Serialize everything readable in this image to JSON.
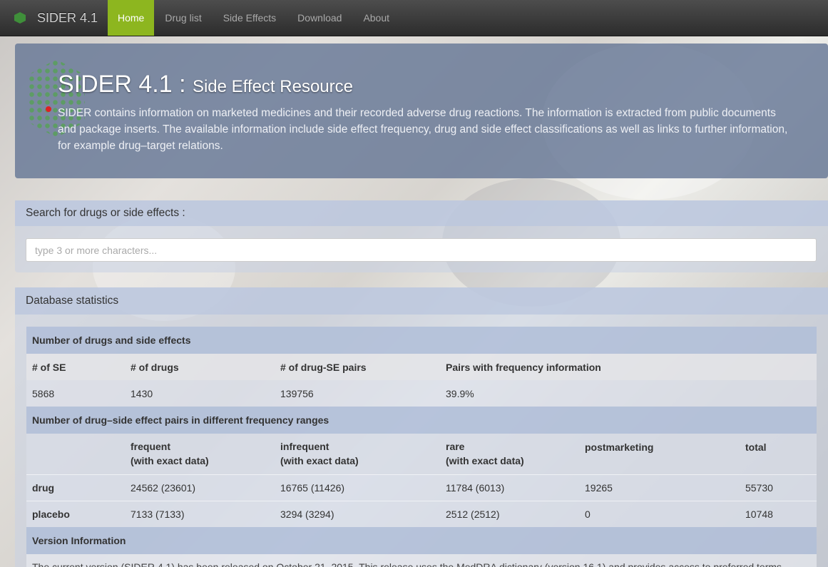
{
  "navbar": {
    "brand": "SIDER 4.1",
    "items": [
      {
        "label": "Home",
        "active": true
      },
      {
        "label": "Drug list",
        "active": false
      },
      {
        "label": "Side Effects",
        "active": false
      },
      {
        "label": "Download",
        "active": false
      },
      {
        "label": "About",
        "active": false
      }
    ]
  },
  "hero": {
    "title": "SIDER 4.1",
    "separator": " : ",
    "subtitle": "Side Effect Resource",
    "text": "SIDER contains information on marketed medicines and their recorded adverse drug reactions. The information is extracted from public documents and package inserts. The available information include side effect frequency, drug and side effect classifications as well as links to further information, for example drug–target relations."
  },
  "search": {
    "heading": "Search for drugs or side effects :",
    "placeholder": "type 3 or more characters..."
  },
  "stats": {
    "heading": "Database statistics",
    "section1": "Number of drugs and side effects",
    "columns1": [
      "# of SE",
      "# of drugs",
      "# of drug-SE pairs",
      "Pairs with frequency information"
    ],
    "values1": [
      "5868",
      "1430",
      "139756",
      "39.9%"
    ],
    "section2": "Number of drug–side effect pairs in different frequency ranges",
    "columns2": [
      {
        "line1": "",
        "line2": ""
      },
      {
        "line1": "frequent",
        "line2": "(with exact data)"
      },
      {
        "line1": "infrequent",
        "line2": "(with exact data)"
      },
      {
        "line1": "rare",
        "line2": "(with exact data)"
      },
      {
        "line1": "postmarketing",
        "line2": ""
      },
      {
        "line1": "total",
        "line2": ""
      }
    ],
    "rows2": [
      [
        "drug",
        "24562 (23601)",
        "16765 (11426)",
        "11784 (6013)",
        "19265",
        "55730"
      ],
      [
        "placebo",
        "7133 (7133)",
        "3294 (3294)",
        "2512 (2512)",
        "0",
        "10748"
      ]
    ],
    "section3": "Version Information",
    "version_text": "The current version (SIDER 4.1) has been released on October 21, 2015. This release uses the MedDRA dictionary (version 16.1) and provides access to preferred terms"
  },
  "colors": {
    "nav_active": "#8db61f",
    "hero_bg": "#677796",
    "logo_green": "#3f8f3a"
  }
}
